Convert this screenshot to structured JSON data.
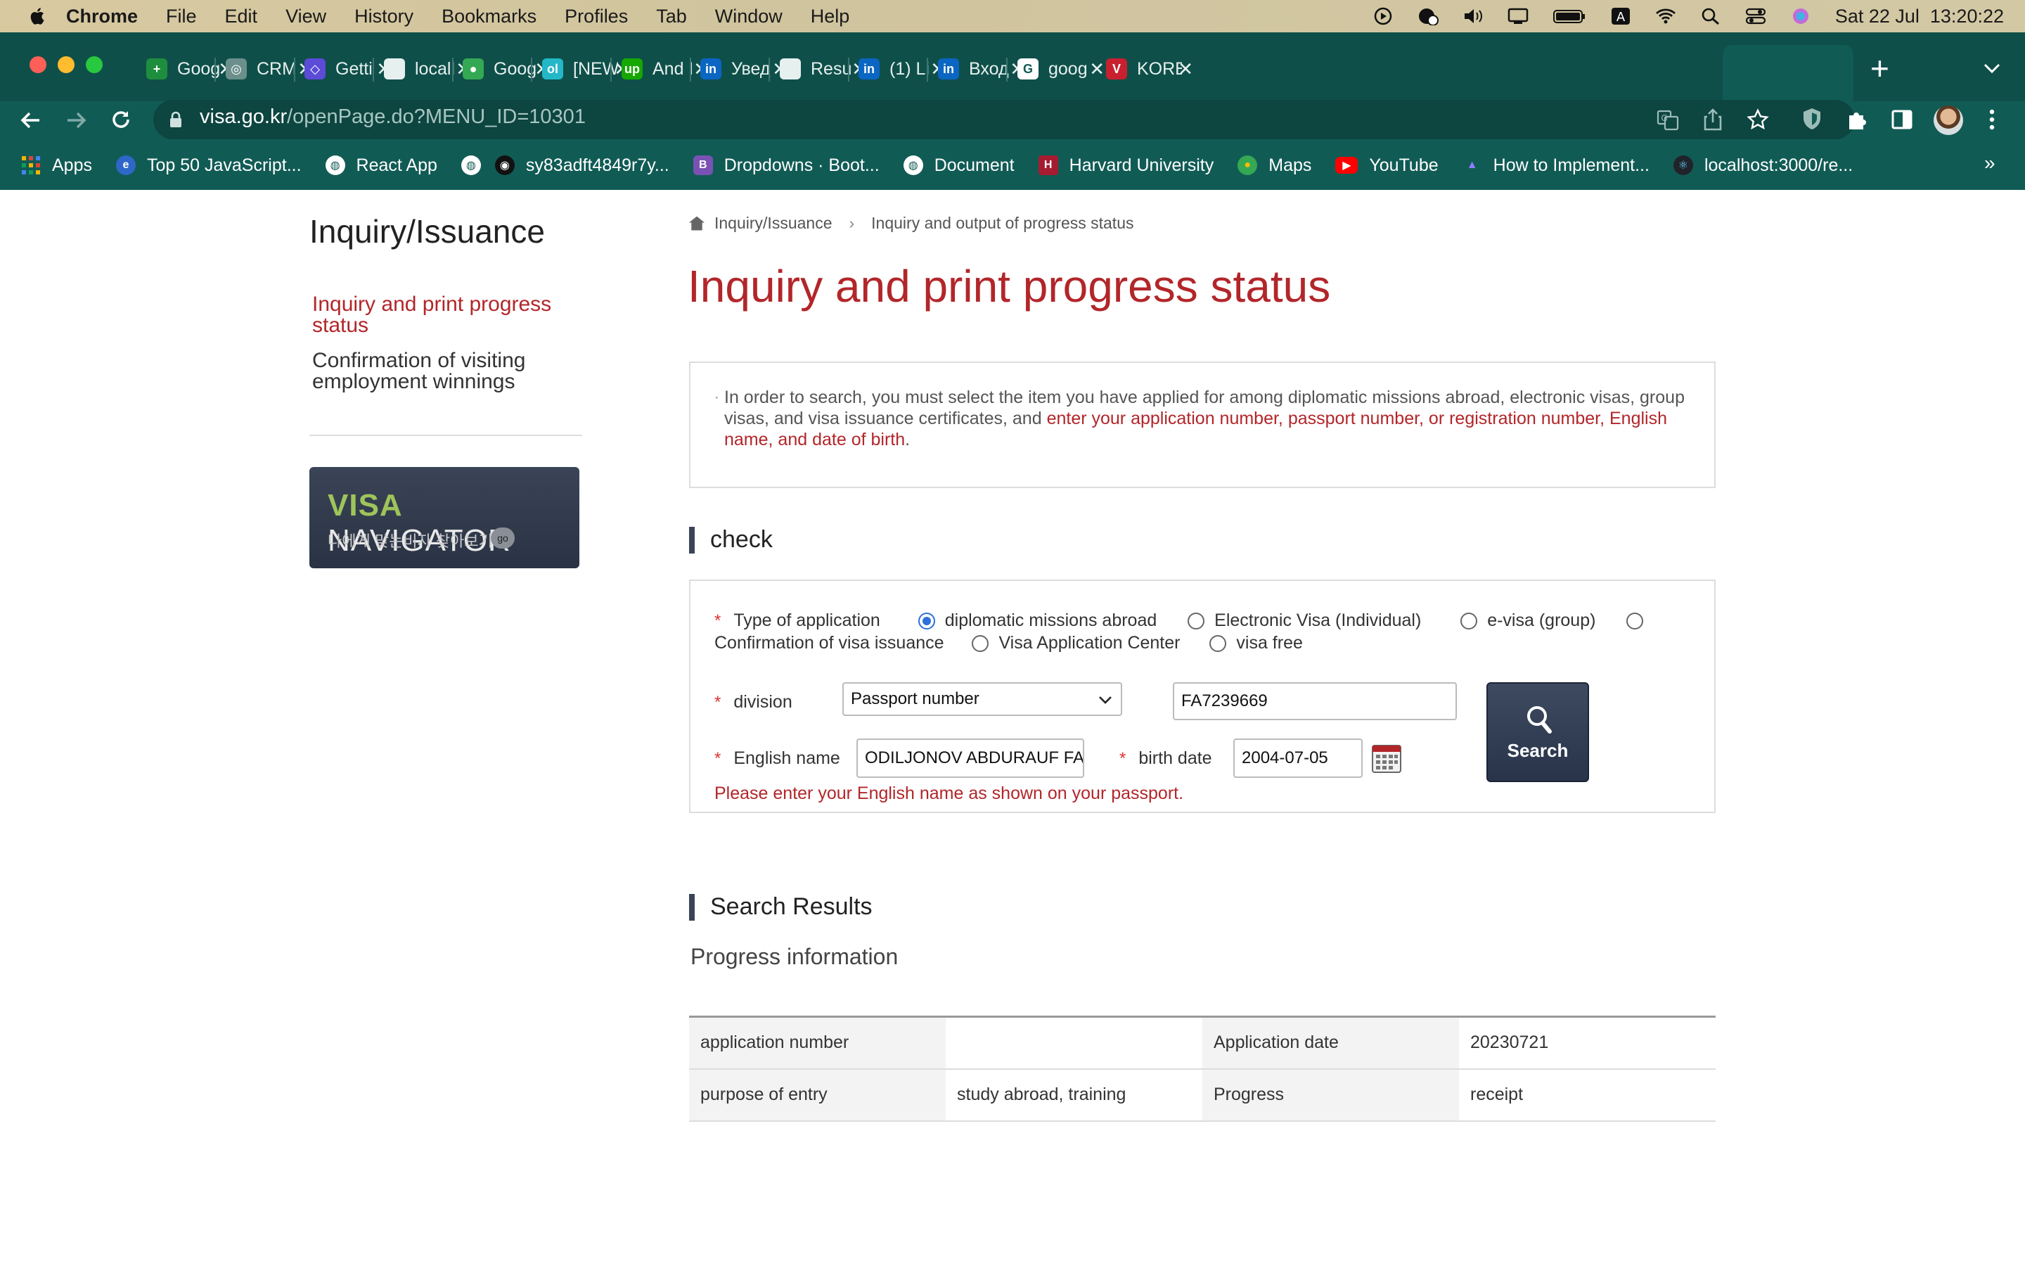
{
  "menubar": {
    "app": "Chrome",
    "items": [
      "File",
      "Edit",
      "View",
      "History",
      "Bookmarks",
      "Profiles",
      "Tab",
      "Window",
      "Help"
    ],
    "clock": "Sat 22 Jul  13:20:22"
  },
  "tabs": [
    {
      "title": "Goog",
      "color": "#1e8e3e",
      "glyph": "+"
    },
    {
      "title": "CRM",
      "color": "#6b8f8b",
      "glyph": "◎"
    },
    {
      "title": "Getti",
      "color": "#5b4bd6",
      "glyph": "◇"
    },
    {
      "title": "locall",
      "color": "#e6f0ee",
      "glyph": ""
    },
    {
      "title": "Goog",
      "color": "#34a853",
      "glyph": "●"
    },
    {
      "title": "[NEW",
      "color": "#23b7c8",
      "glyph": "ol"
    },
    {
      "title": "And I",
      "color": "#14a800",
      "glyph": "up"
    },
    {
      "title": "Увед",
      "color": "#0a66c2",
      "glyph": "in"
    },
    {
      "title": "Resu",
      "color": "#e6f0ee",
      "glyph": ""
    },
    {
      "title": "(1) Li",
      "color": "#0a66c2",
      "glyph": "in"
    },
    {
      "title": "Вход",
      "color": "#0a66c2",
      "glyph": "in"
    },
    {
      "title": "goog",
      "color": "#ffffff",
      "glyph": "G"
    },
    {
      "title": "KORE",
      "color": "#c8202f",
      "glyph": "V"
    }
  ],
  "url": {
    "domain": "visa.go.kr",
    "path": "/openPage.do?MENU_ID=10301"
  },
  "bookmarks": [
    {
      "label": "Apps"
    },
    {
      "label": "Top 50 JavaScript..."
    },
    {
      "label": "React App"
    },
    {
      "label": ""
    },
    {
      "label": "sy83adft4849r7y..."
    },
    {
      "label": "Dropdowns · Boot..."
    },
    {
      "label": "Document"
    },
    {
      "label": "Harvard University"
    },
    {
      "label": "Maps"
    },
    {
      "label": "YouTube"
    },
    {
      "label": "How to Implement..."
    },
    {
      "label": "localhost:3000/re..."
    }
  ],
  "sidebar": {
    "title": "Inquiry/Issuance",
    "active_link": "Inquiry and print progress status",
    "other_link": "Confirmation of visiting employment winnings",
    "banner_title_a": "VISA",
    "banner_title_b": " NAVIGATOR",
    "banner_sub": "나에게 맞는비자 찾아보기",
    "banner_go": "go"
  },
  "breadcrumb": {
    "level1": "Inquiry/Issuance",
    "level2": "Inquiry and output of progress status"
  },
  "page_title": "Inquiry and print progress status",
  "info": {
    "text_a": "In order to search, you must select the item you have applied for among diplomatic missions abroad, electronic visas, group visas, and visa issuance certificates, and ",
    "text_b": "enter your application number, passport number, or registration number, English name, and date of birth",
    "text_c": "."
  },
  "check": {
    "section_title": "check",
    "type_label": "Type of application",
    "types": [
      {
        "label": "diplomatic missions abroad",
        "selected": true
      },
      {
        "label": "Electronic Visa (Individual)",
        "selected": false
      },
      {
        "label": "e-visa (group)",
        "selected": false
      },
      {
        "label": "Confirmation of visa issuance",
        "selected": false
      },
      {
        "label": "Visa Application Center",
        "selected": false
      },
      {
        "label": "visa free",
        "selected": false
      }
    ],
    "division_label": "division",
    "division_value": "Passport number",
    "passport_value": "FA7239669",
    "english_name_label": "English name",
    "english_name_value": "ODILJONOV ABDURAUF FA",
    "birth_label": "birth date",
    "birth_value": "2004-07-05",
    "note": "Please enter your English name as shown on your passport.",
    "search_label": "Search"
  },
  "results": {
    "section_title": "Search Results",
    "subtitle": "Progress information",
    "rows": [
      [
        "application number",
        "",
        "Application date",
        "20230721"
      ],
      [
        "purpose of entry",
        "study abroad, training",
        "Progress",
        "receipt"
      ]
    ]
  }
}
